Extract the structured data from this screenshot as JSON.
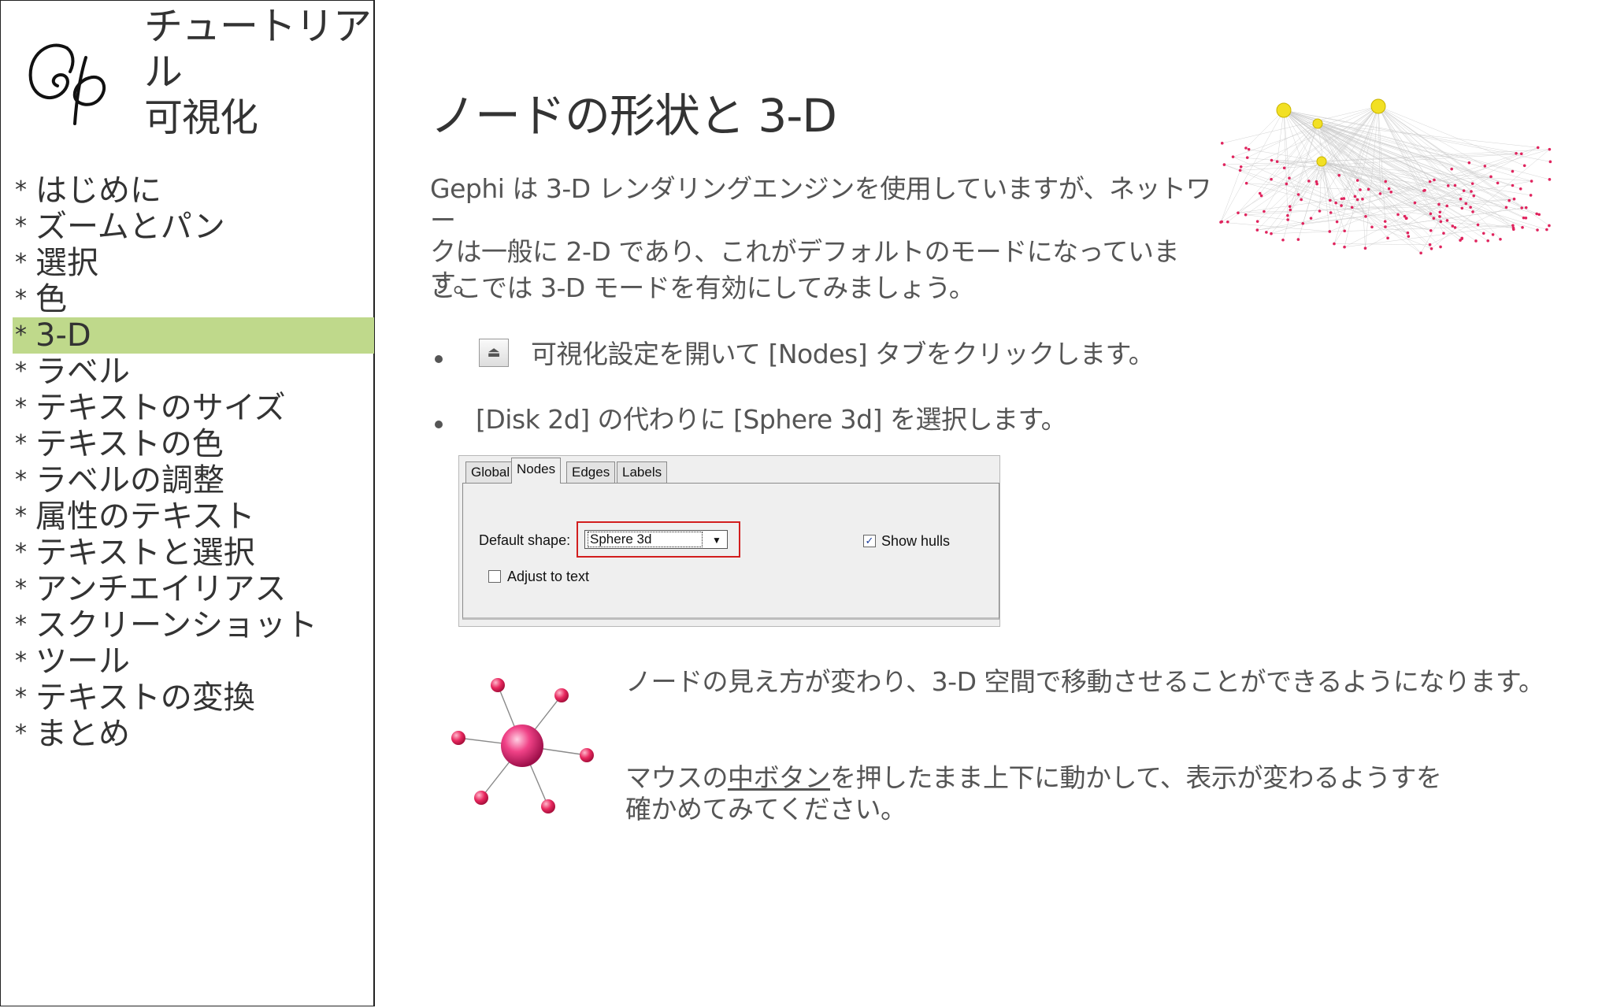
{
  "sidebar": {
    "title": "チュートリアル\n可視化",
    "toc": [
      {
        "label": "はじめに"
      },
      {
        "label": "ズームとパン"
      },
      {
        "label": "選択"
      },
      {
        "label": "色"
      },
      {
        "label": "3-D",
        "active": true
      },
      {
        "label": "ラベル"
      },
      {
        "label": "テキストのサイズ"
      },
      {
        "label": "テキストの色"
      },
      {
        "label": "ラベルの調整"
      },
      {
        "label": "属性のテキスト"
      },
      {
        "label": "テキストと選択"
      },
      {
        "label": "アンチエイリアス"
      },
      {
        "label": "スクリーンショット"
      },
      {
        "label": "ツール"
      },
      {
        "label": "テキストの変換"
      },
      {
        "label": "まとめ"
      }
    ]
  },
  "main": {
    "title": "ノードの形状と 3-D",
    "intro": "Gephi は 3-D レンダリングエンジンを使用していますが、ネットワー\nクは一般に 2-D であり、これがデフォルトのモードになっています。",
    "intro2": "ここでは 3-D モードを有効にしてみましょう。",
    "step1": "可視化設定を開いて [Nodes] タブをクリックします。",
    "step2": "[Disk 2d] の代わりに [Sphere 3d] を選択します。",
    "desc1": "ノードの見え方が変わり、3-D 空間で移動させることができるようになります。",
    "desc2_pre": "マウスの",
    "desc2_link": "中ボタン",
    "desc2_post": "を押したまま上下に動かして、表示が変わるようすを\n確かめてみてください。"
  },
  "dialog": {
    "tabs": [
      "Global",
      "Nodes",
      "Edges",
      "Labels"
    ],
    "selected_tab": "Nodes",
    "shape_label": "Default shape:",
    "shape_value": "Sphere 3d",
    "show_hulls_label": "Show hulls",
    "show_hulls_checked": true,
    "adjust_label": "Adjust to text",
    "adjust_checked": false
  },
  "colors": {
    "active_item": "#bfd98b",
    "highlight_border": "#d21e1e",
    "node_pink": "#e0245e",
    "node_yellow": "#f2e024"
  }
}
